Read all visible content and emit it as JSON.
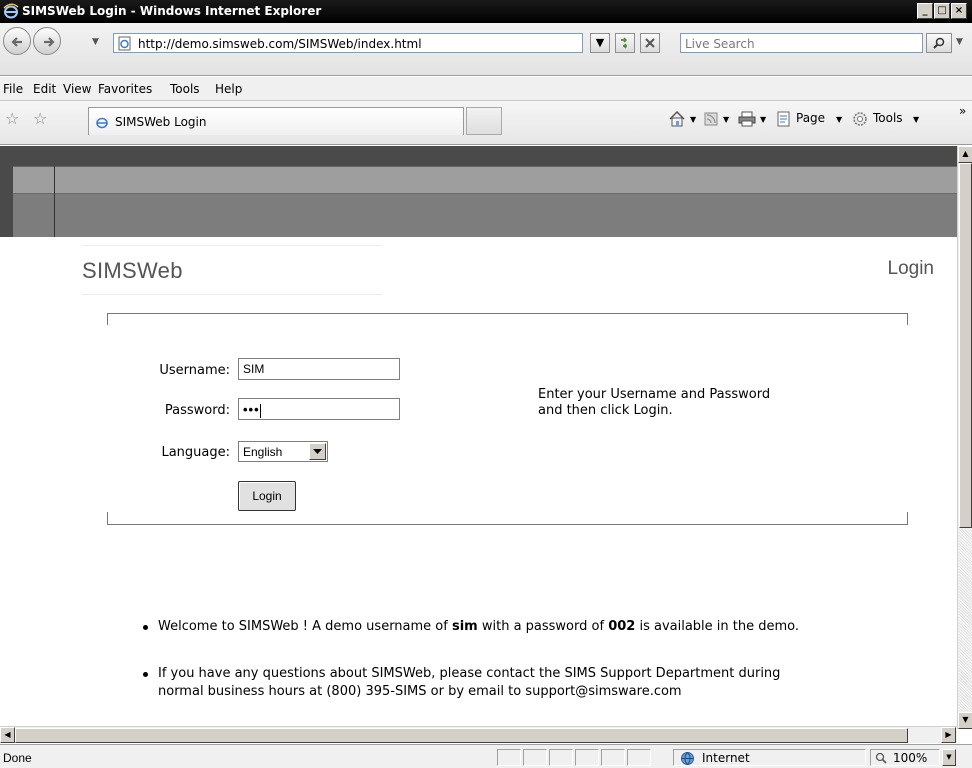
{
  "window": {
    "title": "SIMSWeb Login - Windows Internet Explorer",
    "minimize": "_",
    "maximize": "□",
    "close": "×"
  },
  "address_bar": {
    "url": "http://demo.simsweb.com/SIMSWeb/index.html",
    "search_placeholder": "Live Search",
    "refresh_icon": "refresh-icon",
    "stop_icon": "stop-icon"
  },
  "menu": {
    "items": [
      "File",
      "Edit",
      "View",
      "Favorites",
      "Tools",
      "Help"
    ]
  },
  "tabs": {
    "active_label": "SIMSWeb Login"
  },
  "command_bar": {
    "page_label": "Page",
    "tools_label": "Tools",
    "more": "»"
  },
  "page": {
    "brand": "SIMSWeb",
    "heading": "Login",
    "username_label": "Username:",
    "username_value": "SIM",
    "password_label": "Password:",
    "password_value": "•••",
    "language_label": "Language:",
    "language_value": "English",
    "login_button": "Login",
    "instructions_line1": "Enter your Username and Password",
    "instructions_line2": "and then click Login.",
    "info1_pre": "Welcome to SIMSWeb ! A demo username of ",
    "info1_user": "sim",
    "info1_mid": " with a password of ",
    "info1_pass": "002",
    "info1_post": " is available in the demo.",
    "info2_line1": "If you have any questions about SIMSWeb, please contact the SIMS Support Department during",
    "info2_line2": "normal business hours at (800) 395-SIMS or by email to support@simsware.com"
  },
  "status": {
    "text": "Done",
    "zone": "Internet",
    "zoom": "100%"
  },
  "colors": {
    "header_dark": "#4a4a4a",
    "header_band": "#9e9e9e",
    "header_band2": "#7d7d7d",
    "brand_text": "#555555",
    "link_blue": "#1e5fb4"
  }
}
